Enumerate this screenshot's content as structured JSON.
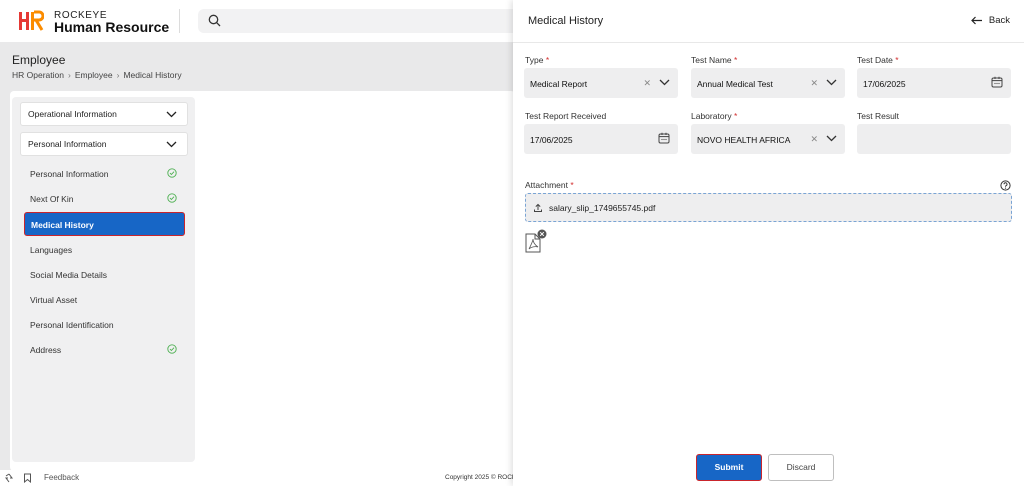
{
  "brand": {
    "line1": "ROCKEYE",
    "line2": "Human Resource",
    "colors": {
      "h": "#e53935",
      "r": "#fb8c00"
    }
  },
  "header": {
    "search_icon": "search-icon"
  },
  "page": {
    "title": "Employee",
    "breadcrumbs": [
      "HR Operation",
      "Employee",
      "Medical History"
    ]
  },
  "sidebar": {
    "sections": [
      {
        "label": "Operational Information"
      },
      {
        "label": "Personal Information"
      }
    ],
    "items": [
      {
        "label": "Personal Information",
        "done": true
      },
      {
        "label": "Next Of Kin",
        "done": true
      },
      {
        "label": "Medical History",
        "active": true
      },
      {
        "label": "Languages"
      },
      {
        "label": "Social Media Details"
      },
      {
        "label": "Virtual Asset"
      },
      {
        "label": "Personal Identification"
      },
      {
        "label": "Address",
        "done": true
      }
    ]
  },
  "footer": {
    "feedback": "Feedback",
    "copyright": "Copyright 2025 © ROCKE"
  },
  "drawer": {
    "title": "Medical History",
    "back_label": "Back",
    "fields": {
      "type": {
        "label": "Type",
        "required": "*",
        "value": "Medical Report"
      },
      "test_name": {
        "label": "Test Name",
        "required": "*",
        "value": "Annual Medical Test"
      },
      "test_date": {
        "label": "Test Date",
        "required": "*",
        "value": "17/06/2025"
      },
      "report_received": {
        "label": "Test Report Received",
        "value": "17/06/2025"
      },
      "laboratory": {
        "label": "Laboratory",
        "required": "*",
        "value": "NOVO HEALTH AFRICA"
      },
      "test_result": {
        "label": "Test Result",
        "value": ""
      }
    },
    "attachment": {
      "label": "Attachment",
      "required": "*",
      "filename": "salary_slip_1749655745.pdf"
    },
    "actions": {
      "submit": "Submit",
      "discard": "Discard"
    },
    "accent_color": "#1766c6"
  }
}
